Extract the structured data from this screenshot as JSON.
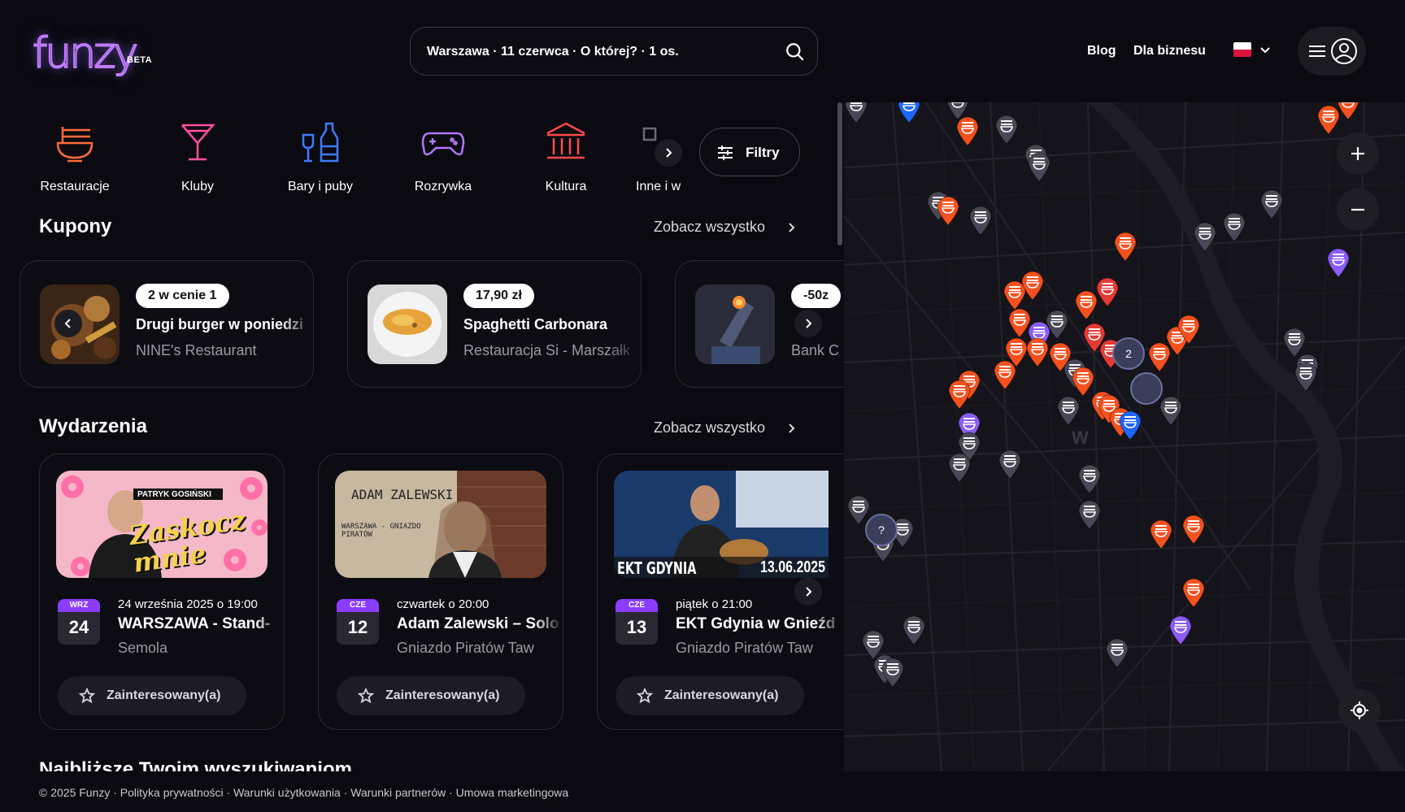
{
  "header": {
    "logo_text": "funzy",
    "logo_badge": "BETA",
    "search_text": "Warszawa · 11 czerwca · O której? · 1 os.",
    "nav": [
      "Blog",
      "Dla biznesu"
    ]
  },
  "categories": [
    "Restauracje",
    "Kluby",
    "Bary i puby",
    "Rozrywka",
    "Kultura",
    "Inne i w"
  ],
  "filters_label": "Filtry",
  "coupons": {
    "title": "Kupony",
    "see_all": "Zobacz wszystko",
    "items": [
      {
        "badge": "2 w cenie 1",
        "title": "Drugi burger w poniedzi",
        "place": "NINE's Restaurant"
      },
      {
        "badge": "17,90 zł",
        "title": "Spaghetti Carbonara",
        "place": "Restauracja Si - Marszałk"
      },
      {
        "badge": "-50z",
        "title": "",
        "place": "Bank C"
      }
    ]
  },
  "events": {
    "title": "Wydarzenia",
    "see_all": "Zobacz wszystko",
    "items": [
      {
        "month": "WRZ",
        "day": "24",
        "date": "24 września 2025 o 19:00",
        "title": "WARSZAWA - Stand-",
        "venue": "Semola",
        "interest": "Zainteresowany(a)",
        "poster_top": "PATRYK GOSIŃSKI",
        "poster_main": "Zaskocz mnie"
      },
      {
        "month": "CZE",
        "day": "12",
        "date": "czwartek o 20:00",
        "title": "Adam Zalewski – Solo",
        "venue": "Gniazdo Piratów Taw",
        "interest": "Zainteresowany(a)",
        "poster_top": "ADAM ZALEWSKI",
        "poster_main": "WARSZAWA - GNIAZDO PIRATÓW"
      },
      {
        "month": "CZE",
        "day": "13",
        "date": "piątek o 21:00",
        "title": "EKT Gdynia w Gnieźd",
        "venue": "Gniazdo Piratów Taw",
        "interest": "Zainteresowany(a)",
        "poster_top": "EKT GDYNIA",
        "poster_main": "13.06.2025"
      }
    ]
  },
  "next_section_title": "Najbliższe Twoim wyszukiwaniom",
  "footer": "© 2025 Funzy · Polityka prywatności · Warunki użytkowania · Warunki partnerów · Umowa marketingowa",
  "map": {
    "cluster_labels": [
      "2",
      "?"
    ],
    "district_label": "W",
    "colors": {
      "restaurant": "#f4511e",
      "other": "#4a4856",
      "bar": "#1e66ff",
      "entertainment": "#8b5cf6",
      "culture": "#e53935"
    }
  },
  "icons": [
    "search-icon",
    "chevron-down-icon",
    "menu-icon",
    "profile-icon",
    "noodle-bowl-icon",
    "cocktail-icon",
    "bottle-icon",
    "gamepad-icon",
    "museum-icon",
    "chevron-right-icon",
    "chevron-left-icon",
    "sliders-icon",
    "star-icon",
    "plus-icon",
    "minus-icon",
    "locate-icon"
  ]
}
